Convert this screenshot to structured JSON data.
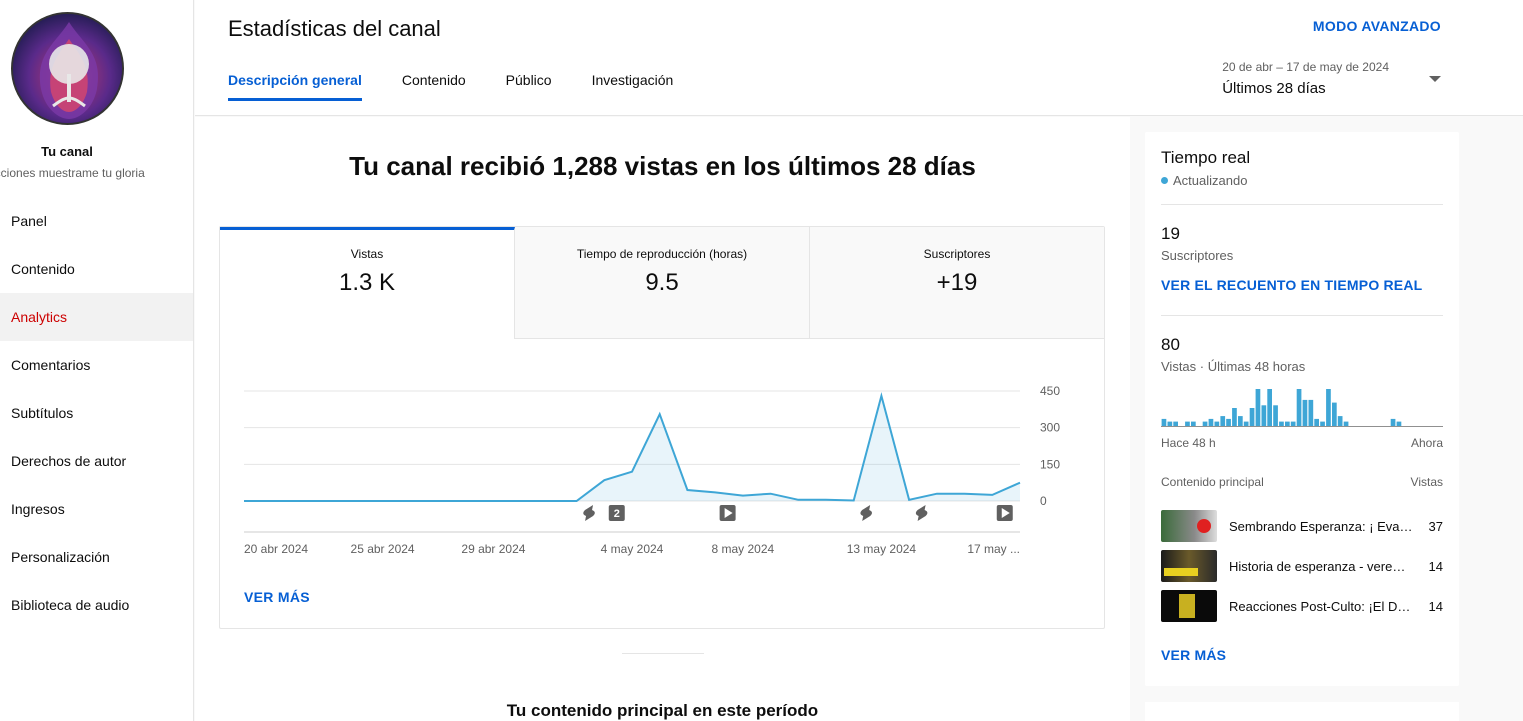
{
  "sidebar": {
    "channel_name": "Tu canal",
    "channel_subtitle": "ucciones muestrame tu gloria",
    "items": [
      {
        "label": "Panel"
      },
      {
        "label": "Contenido"
      },
      {
        "label": "Analytics",
        "active": true
      },
      {
        "label": "Comentarios"
      },
      {
        "label": "Subtítulos"
      },
      {
        "label": "Derechos de autor"
      },
      {
        "label": "Ingresos"
      },
      {
        "label": "Personalización"
      },
      {
        "label": "Biblioteca de audio"
      }
    ]
  },
  "header": {
    "title": "Estadísticas del canal",
    "advanced_mode": "MODO AVANZADO",
    "tabs": [
      {
        "label": "Descripción general",
        "active": true
      },
      {
        "label": "Contenido"
      },
      {
        "label": "Público"
      },
      {
        "label": "Investigación"
      }
    ],
    "date_range": "20 de abr – 17 de may de 2024",
    "period_label": "Últimos 28 días"
  },
  "main": {
    "headline": "Tu canal recibió 1,288 vistas en los últimos 28 días",
    "metrics": [
      {
        "label": "Vistas",
        "value": "1.3 K",
        "active": true
      },
      {
        "label": "Tiempo de reproducción (horas)",
        "value": "9.5"
      },
      {
        "label": "Suscriptores",
        "value": "+19"
      }
    ],
    "see_more": "VER MÁS",
    "section_title": "Tu contenido principal en este período"
  },
  "chart_data": {
    "type": "area",
    "series_label": "Vistas",
    "x_tick_labels": [
      "20 abr 2024",
      "25 abr 2024",
      "29 abr 2024",
      "4 may 2024",
      "8 may 2024",
      "13 may 2024",
      "17 may ..."
    ],
    "x": [
      "2024-04-20",
      "2024-04-21",
      "2024-04-22",
      "2024-04-23",
      "2024-04-24",
      "2024-04-25",
      "2024-04-26",
      "2024-04-27",
      "2024-04-28",
      "2024-04-29",
      "2024-04-30",
      "2024-05-01",
      "2024-05-02",
      "2024-05-03",
      "2024-05-04",
      "2024-05-05",
      "2024-05-06",
      "2024-05-07",
      "2024-05-08",
      "2024-05-09",
      "2024-05-10",
      "2024-05-11",
      "2024-05-12",
      "2024-05-13",
      "2024-05-14",
      "2024-05-15",
      "2024-05-16",
      "2024-05-17"
    ],
    "values": [
      0,
      0,
      0,
      0,
      0,
      0,
      0,
      0,
      0,
      0,
      0,
      0,
      0,
      85,
      120,
      355,
      45,
      35,
      22,
      30,
      5,
      5,
      2,
      430,
      5,
      30,
      30,
      25,
      75
    ],
    "y_ticks": [
      0,
      150,
      300,
      450
    ],
    "ylim": [
      0,
      450
    ],
    "grid": true,
    "markers": [
      {
        "type": "short",
        "index": 12
      },
      {
        "type": "count",
        "label": "2",
        "index": 13
      },
      {
        "type": "video",
        "index": 17
      },
      {
        "type": "short",
        "index": 22
      },
      {
        "type": "short",
        "index": 24
      },
      {
        "type": "video",
        "index": 27
      }
    ]
  },
  "realtime": {
    "title": "Tiempo real",
    "status": "Actualizando",
    "subscribers_value": "19",
    "subscribers_label": "Suscriptores",
    "realtime_link": "VER EL RECUENTO EN TIEMPO REAL",
    "views_value": "80",
    "views_label": "Vistas · Últimas 48 horas",
    "views_48h": [
      3,
      2,
      2,
      0,
      2,
      2,
      0,
      2,
      3,
      2,
      4,
      3,
      7,
      4,
      2,
      7,
      14,
      8,
      14,
      8,
      2,
      2,
      2,
      14,
      10,
      10,
      3,
      2,
      14,
      9,
      4,
      2,
      0,
      0,
      0,
      0,
      0,
      0,
      0,
      3,
      2,
      0,
      0,
      0,
      0,
      0,
      0,
      0
    ],
    "axis_start": "Hace 48 h",
    "axis_end": "Ahora",
    "top_content_header": "Contenido principal",
    "top_views_header": "Vistas",
    "top_content": [
      {
        "title": "Sembrando Esperanza: ¡ Evangelizando con amor!",
        "views": "37"
      },
      {
        "title": "Historia de esperanza - veremos la gloria de Dios",
        "views": "14"
      },
      {
        "title": "Reacciones Post-Culto: ¡El Dios que nos salva!",
        "views": "14"
      }
    ],
    "see_more": "VER MÁS"
  }
}
